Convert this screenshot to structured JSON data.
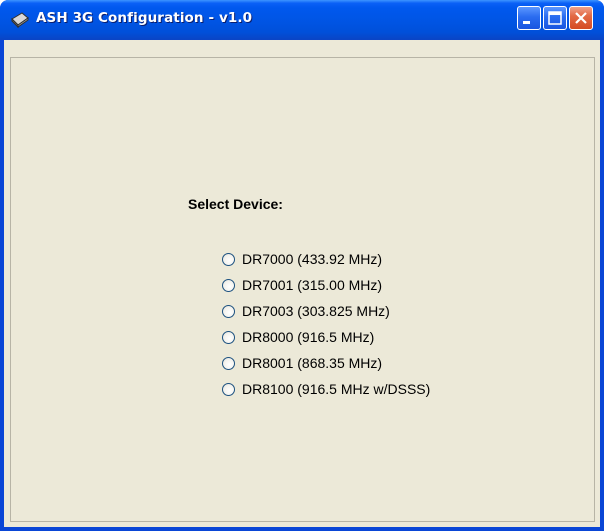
{
  "window": {
    "title": "ASH 3G Configuration - v1.0",
    "icons": {
      "app": "app-icon",
      "minimize": "minimize-icon",
      "maximize": "maximize-icon",
      "close": "close-icon"
    }
  },
  "main": {
    "group_label": "Select Device:",
    "options": [
      {
        "label": "DR7000 (433.92 MHz)",
        "selected": false
      },
      {
        "label": "DR7001 (315.00 MHz)",
        "selected": false
      },
      {
        "label": "DR7003 (303.825 MHz)",
        "selected": false
      },
      {
        "label": "DR8000 (916.5 MHz)",
        "selected": false
      },
      {
        "label": "DR8001 (868.35 MHz)",
        "selected": false
      },
      {
        "label": "DR8100 (916.5 MHz w/DSSS)",
        "selected": false
      }
    ]
  },
  "colors": {
    "titlebar_blue": "#0054e3",
    "client_background": "#ece9d8",
    "close_button_red": "#d44a22"
  }
}
